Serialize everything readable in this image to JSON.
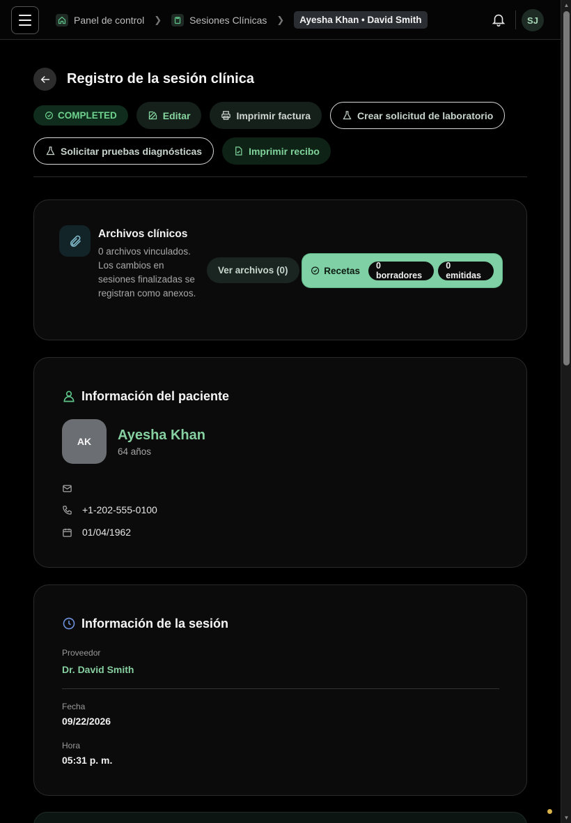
{
  "breadcrumbs": {
    "items": [
      "Panel de control",
      "Sesiones Clínicas"
    ],
    "current": "Ayesha Khan • David Smith"
  },
  "user": {
    "initials": "SJ"
  },
  "page": {
    "title": "Registro de la sesión clínica"
  },
  "actions": {
    "status": "COMPLETED",
    "edit": "Editar",
    "print_invoice": "Imprimir factura",
    "create_lab_request": "Crear solicitud de laboratorio",
    "request_diagnostics": "Solicitar pruebas diagnósticas",
    "print_receipt": "Imprimir recibo"
  },
  "files": {
    "title": "Archivos clínicos",
    "description": "0 archivos vinculados. Los cambios en sesiones finalizadas se registran como anexos.",
    "view_button": "Ver archivos (0)",
    "recipes_label": "Recetas",
    "drafts": "0 borradores",
    "issued": "0 emitidas"
  },
  "patient": {
    "section_title": "Información del paciente",
    "initials": "AK",
    "name": "Ayesha Khan",
    "age": "64 años",
    "email": "",
    "phone": "+1-202-555-0100",
    "birthdate": "01/04/1962"
  },
  "session": {
    "section_title": "Información de la sesión",
    "provider_label": "Proveedor",
    "provider": "Dr. David Smith",
    "date_label": "Fecha",
    "date": "09/22/2026",
    "time_label": "Hora",
    "time": "05:31 p. m."
  },
  "colors": {
    "accent_green": "#86cfa0",
    "status_green": "#6fd38f",
    "recipes_bg": "#7fd0a4"
  }
}
